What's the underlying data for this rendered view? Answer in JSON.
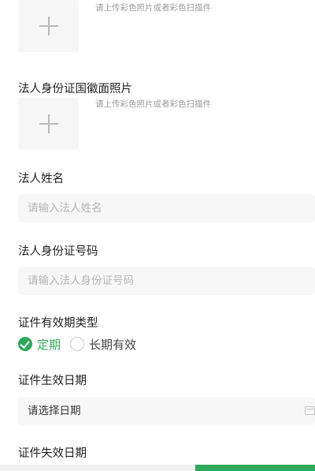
{
  "front_upload": {
    "hint": "请上传彩色照片或者彩色扫描件"
  },
  "emblem_upload": {
    "label": "法人身份证国徽面照片",
    "hint": "请上传彩色照片或者彩色扫描件"
  },
  "legal_name": {
    "label": "法人姓名",
    "placeholder": "请输入法人姓名"
  },
  "id_number": {
    "label": "法人身份证号码",
    "placeholder": "请输入法人身份证号码"
  },
  "validity_type": {
    "label": "证件有效期类型",
    "options": [
      {
        "label": "定期",
        "checked": true
      },
      {
        "label": "长期有效",
        "checked": false
      }
    ]
  },
  "effective_date": {
    "label": "证件生效日期",
    "value": "请选择日期"
  },
  "expiry_date": {
    "label": "证件失效日期"
  },
  "colors": {
    "accent": "#2fa85a"
  },
  "icons": {
    "upload": "plus-icon",
    "checked": "check-circle-icon",
    "calendar": "calendar-icon"
  }
}
